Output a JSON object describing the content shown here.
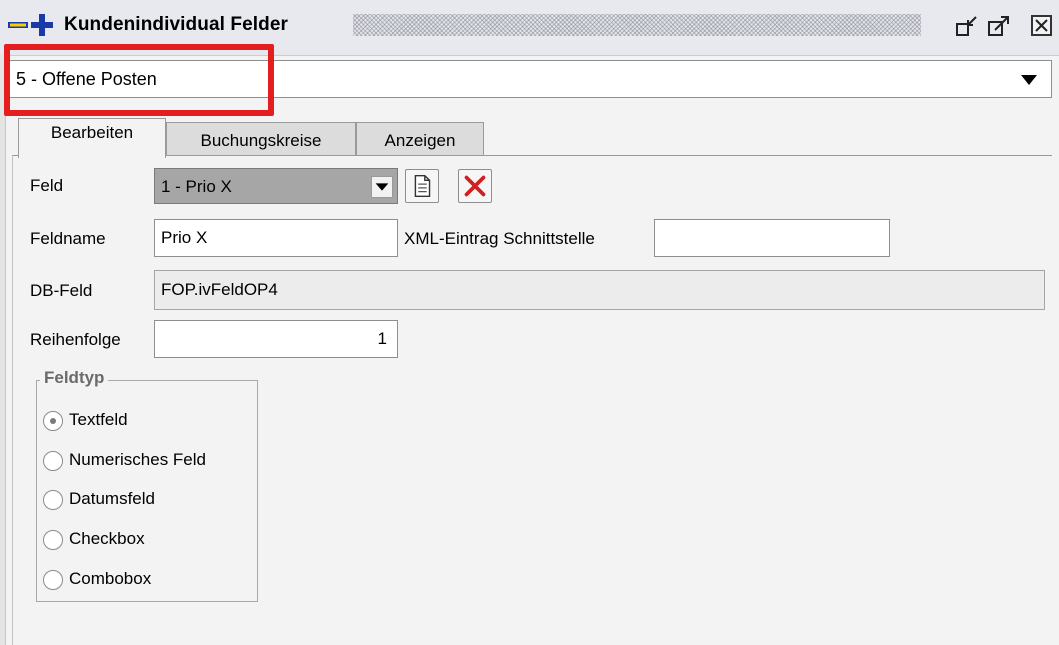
{
  "window": {
    "title": "Kundenindividual Felder",
    "buttons": {
      "undock": "undock-icon",
      "maximize": "maximize-icon",
      "close": "close-icon"
    }
  },
  "combo": {
    "value": "5 - Offene Posten"
  },
  "tabs": [
    {
      "label": "Bearbeiten",
      "active": true
    },
    {
      "label": "Buchungskreise",
      "active": false
    },
    {
      "label": "Anzeigen",
      "active": false
    }
  ],
  "form": {
    "feld_label": "Feld",
    "feld_value": "1 - Prio X",
    "feldname_label": "Feldname",
    "feldname_value": "Prio X",
    "xml_label": "XML-Eintrag Schnittstelle",
    "xml_value": "",
    "dbfeld_label": "DB-Feld",
    "dbfeld_value": "FOP.ivFeldOP4",
    "reihenfolge_label": "Reihenfolge",
    "reihenfolge_value": "1"
  },
  "feldtyp": {
    "title": "Feldtyp",
    "options": [
      {
        "label": "Textfeld",
        "checked": true
      },
      {
        "label": "Numerisches Feld",
        "checked": false
      },
      {
        "label": "Datumsfeld",
        "checked": false
      },
      {
        "label": "Checkbox",
        "checked": false
      },
      {
        "label": "Combobox",
        "checked": false
      }
    ]
  },
  "colors": {
    "highlight": "#e41e1e",
    "delete_icon": "#d02020",
    "plus_icon": "#1a3aa8",
    "minus_icon": "#f4d000"
  }
}
